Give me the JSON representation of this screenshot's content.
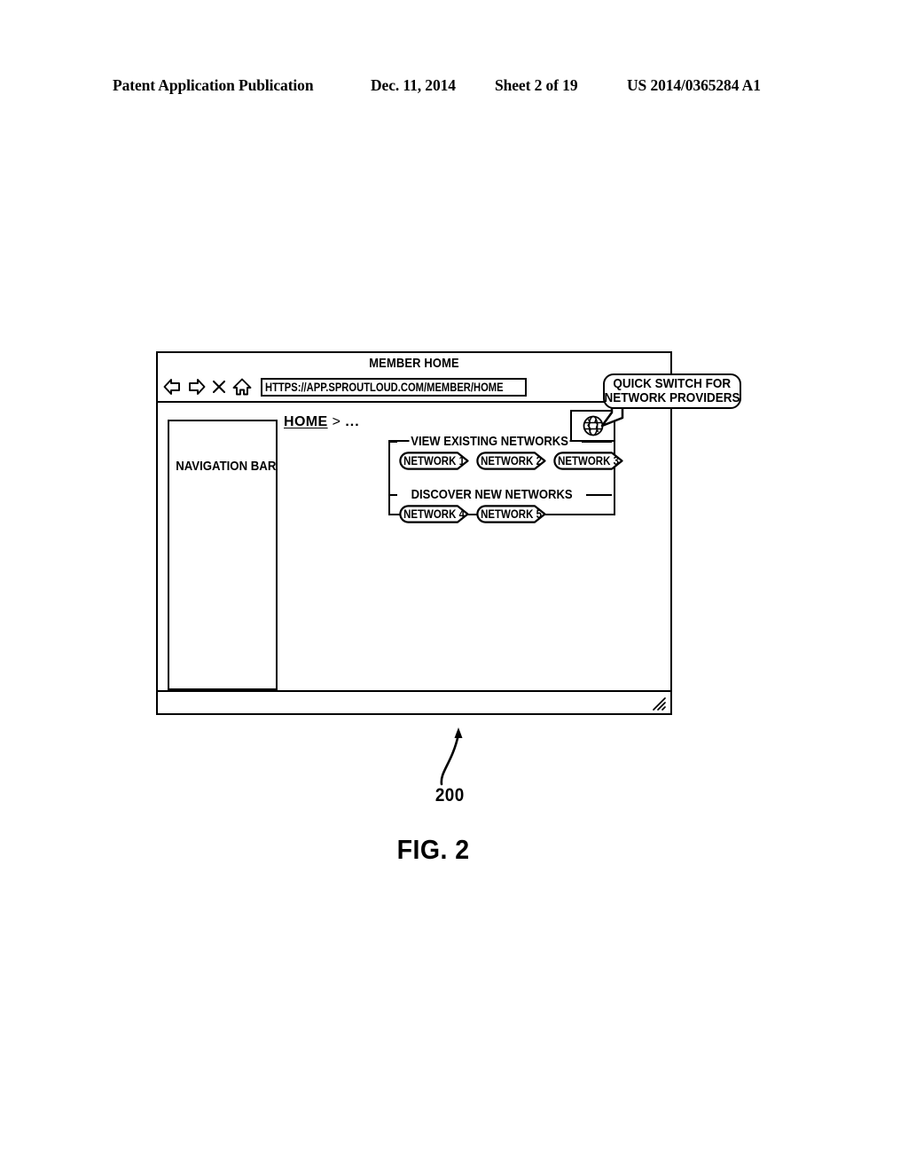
{
  "page_header": {
    "publication": "Patent Application Publication",
    "date": "Dec. 11, 2014",
    "sheet": "Sheet 2 of 19",
    "patent_number": "US 2014/0365284 A1"
  },
  "figure": {
    "label": "FIG. 2",
    "reference_number": "200"
  },
  "browser": {
    "title": "MEMBER HOME",
    "toolbar": {
      "back_icon": "back-arrow-icon",
      "forward_icon": "forward-arrow-icon",
      "stop_icon": "close-x-icon",
      "home_icon": "home-house-icon",
      "url_value": "HTTPS://APP.SPROUTLOUD.COM/MEMBER/HOME"
    },
    "status_bar": {
      "resize_grip_icon": "resize-grip-icon"
    }
  },
  "content": {
    "navigation_bar_label": "NAVIGATION BAR",
    "breadcrumb": {
      "home": "HOME",
      "separator": ">",
      "rest": "..."
    },
    "globe_tab": {
      "icon": "globe-icon"
    }
  },
  "network_panel": {
    "sections": [
      {
        "legend": "VIEW EXISTING NETWORKS",
        "networks": [
          "NETWORK 1",
          "NETWORK 2",
          "NETWORK 3"
        ]
      },
      {
        "legend": "DISCOVER NEW NETWORKS",
        "networks": [
          "NETWORK 4",
          "NETWORK 5"
        ]
      }
    ]
  },
  "callout": {
    "line1": "QUICK SWITCH FOR",
    "line2": "NETWORK PROVIDERS"
  },
  "colors": {
    "ink": "#000000",
    "paper": "#ffffff"
  }
}
